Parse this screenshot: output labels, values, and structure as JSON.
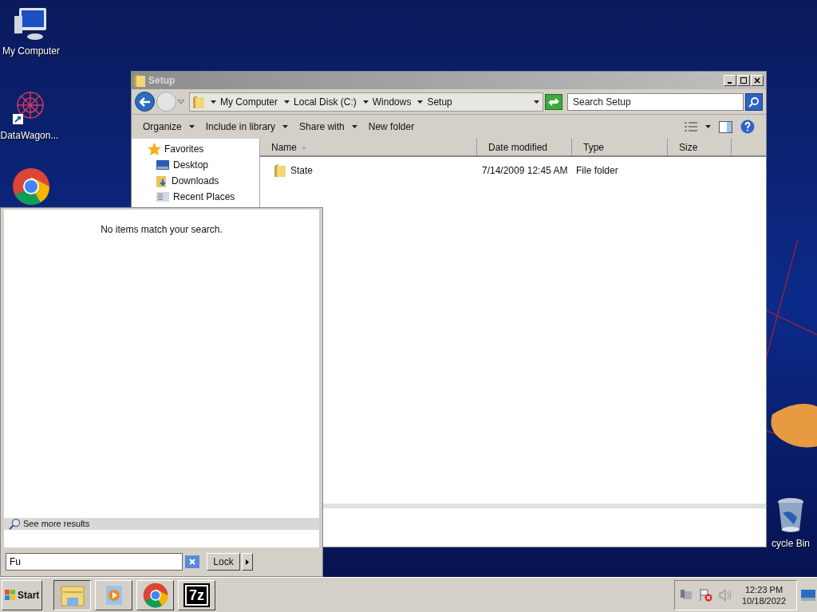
{
  "desktop_icons": [
    {
      "kind": "computer",
      "label": "My Computer"
    },
    {
      "kind": "starburst",
      "label": "DataWagon..."
    },
    {
      "kind": "chrome"
    },
    {
      "kind": "recycle",
      "label": "cycle Bin"
    }
  ],
  "explorer": {
    "title": "Setup",
    "breadcrumbs": [
      "My Computer",
      "Local Disk (C:)",
      "Windows",
      "Setup"
    ],
    "search": {
      "placeholder": "Search Setup"
    },
    "toolbar": [
      {
        "label": "Organize",
        "dropdown": true
      },
      {
        "label": "Include in library",
        "dropdown": true
      },
      {
        "label": "Share with",
        "dropdown": true
      },
      {
        "label": "New folder",
        "dropdown": false
      }
    ],
    "nav": {
      "header": "Favorites",
      "items": [
        {
          "kind": "desktop",
          "label": "Desktop"
        },
        {
          "kind": "downloads",
          "label": "Downloads"
        },
        {
          "kind": "recent",
          "label": "Recent Places"
        }
      ]
    },
    "columns": [
      {
        "label": "Name",
        "sorted": true
      },
      {
        "label": "Date modified",
        "sorted": false
      },
      {
        "label": "Type",
        "sorted": false
      },
      {
        "label": "Size",
        "sorted": false
      }
    ],
    "rows": [
      {
        "name": "State",
        "date": "7/14/2009 12:45 AM",
        "type": "File folder"
      }
    ]
  },
  "start_menu": {
    "message": "No items match your search.",
    "see_more": "See more results",
    "search_value": "Fu",
    "lock": "Lock"
  },
  "taskbar": {
    "start": "Start",
    "buttons": [
      {
        "kind": "explorer",
        "selected": true
      },
      {
        "kind": "media",
        "selected": false
      },
      {
        "kind": "chrome",
        "selected": false
      },
      {
        "kind": "sevenzip",
        "label": "7z",
        "selected": false
      }
    ],
    "tray": [
      {
        "kind": "network"
      },
      {
        "kind": "flag"
      },
      {
        "kind": "speaker"
      }
    ],
    "time": "12:23 PM",
    "date": "10/18/2022"
  }
}
